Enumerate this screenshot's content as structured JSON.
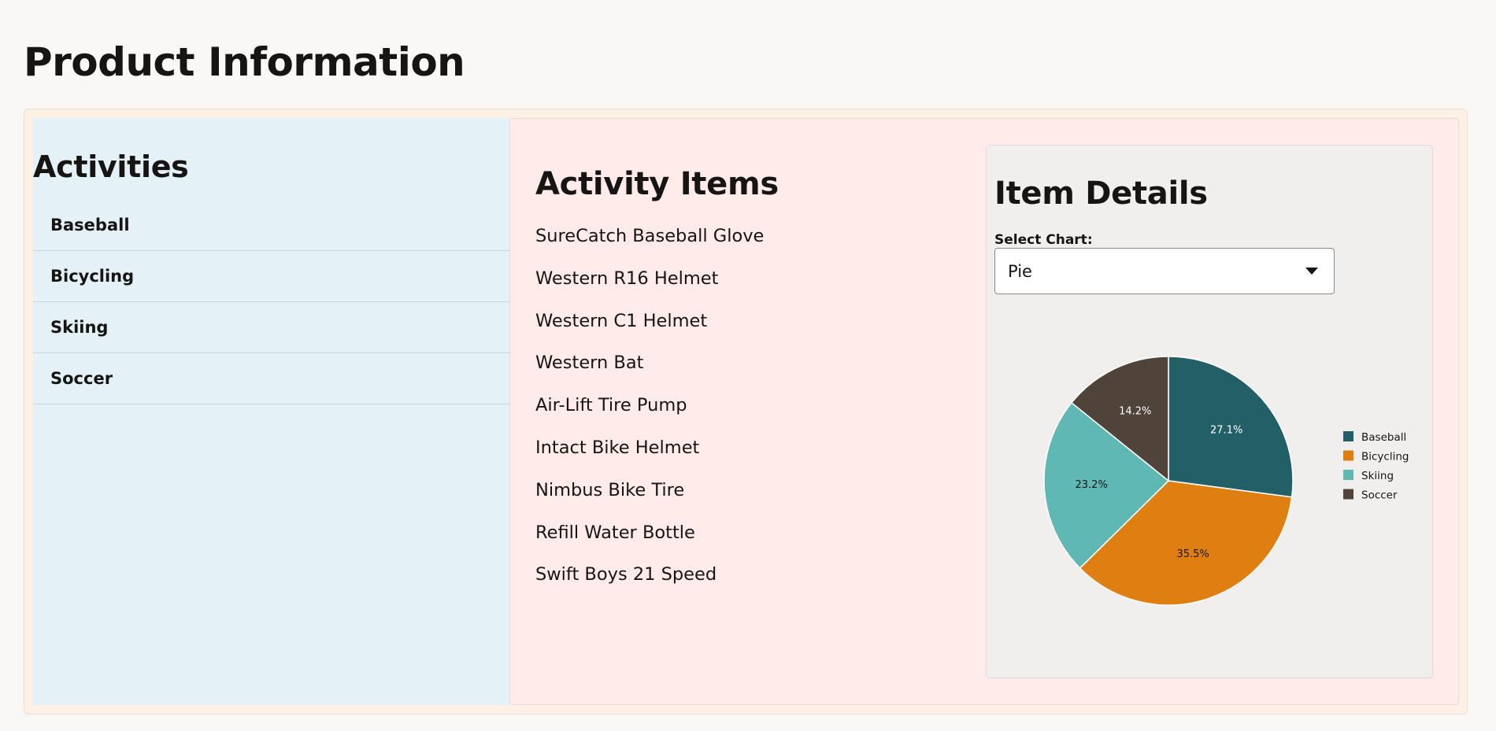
{
  "page": {
    "title": "Product Information"
  },
  "activities": {
    "heading": "Activities",
    "items": [
      {
        "label": "Baseball"
      },
      {
        "label": "Bicycling"
      },
      {
        "label": "Skiing"
      },
      {
        "label": "Soccer"
      }
    ]
  },
  "activity_items": {
    "heading": "Activity Items",
    "items": [
      "SureCatch Baseball Glove",
      "Western R16 Helmet",
      "Western C1 Helmet",
      "Western Bat",
      "Air-Lift Tire Pump",
      "Intact Bike Helmet",
      "Nimbus Bike Tire",
      "Refill Water Bottle",
      "Swift Boys 21 Speed"
    ]
  },
  "item_details": {
    "heading": "Item Details",
    "select_label": "Select Chart:",
    "select_value": "Pie"
  },
  "chart_data": {
    "type": "pie",
    "categories": [
      "Baseball",
      "Bicycling",
      "Skiing",
      "Soccer"
    ],
    "values": [
      27.1,
      35.5,
      23.2,
      14.2
    ],
    "labels": [
      "27.1%",
      "35.5%",
      "23.2%",
      "14.2%"
    ],
    "colors": [
      "#235f66",
      "#e07f11",
      "#5fb8b3",
      "#4f433a"
    ],
    "label_colors": [
      "#ffffff",
      "#161513",
      "#161513",
      "#ffffff"
    ],
    "legend": "right"
  }
}
